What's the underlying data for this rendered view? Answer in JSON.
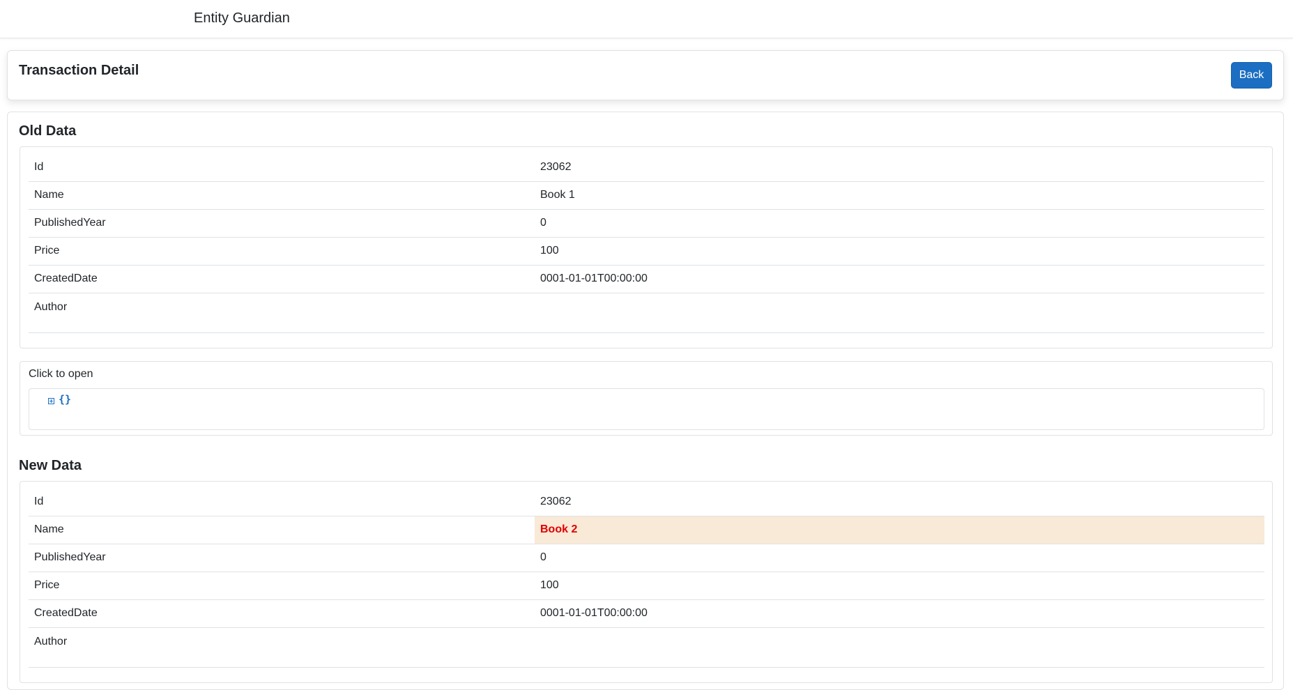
{
  "app": {
    "brand": "Entity Guardian"
  },
  "header": {
    "title": "Transaction Detail",
    "back_label": "Back"
  },
  "old_data": {
    "title": "Old Data",
    "rows": [
      {
        "key": "Id",
        "value": "23062"
      },
      {
        "key": "Name",
        "value": "Book 1"
      },
      {
        "key": "PublishedYear",
        "value": "0"
      },
      {
        "key": "Price",
        "value": "100"
      },
      {
        "key": "CreatedDate",
        "value": "0001-01-01T00:00:00"
      },
      {
        "key": "Author",
        "value": ""
      }
    ]
  },
  "json_viewer": {
    "label": "Click to open",
    "braces": "{}"
  },
  "new_data": {
    "title": "New Data",
    "rows": [
      {
        "key": "Id",
        "value": "23062"
      },
      {
        "key": "Name",
        "value": "Book 2",
        "changed": true
      },
      {
        "key": "PublishedYear",
        "value": "0"
      },
      {
        "key": "Price",
        "value": "100"
      },
      {
        "key": "CreatedDate",
        "value": "0001-01-01T00:00:00"
      },
      {
        "key": "Author",
        "value": ""
      }
    ]
  },
  "colors": {
    "accent": "#1b6ec2",
    "changed_bg": "#f9e9d7",
    "changed_text": "#e00000"
  }
}
